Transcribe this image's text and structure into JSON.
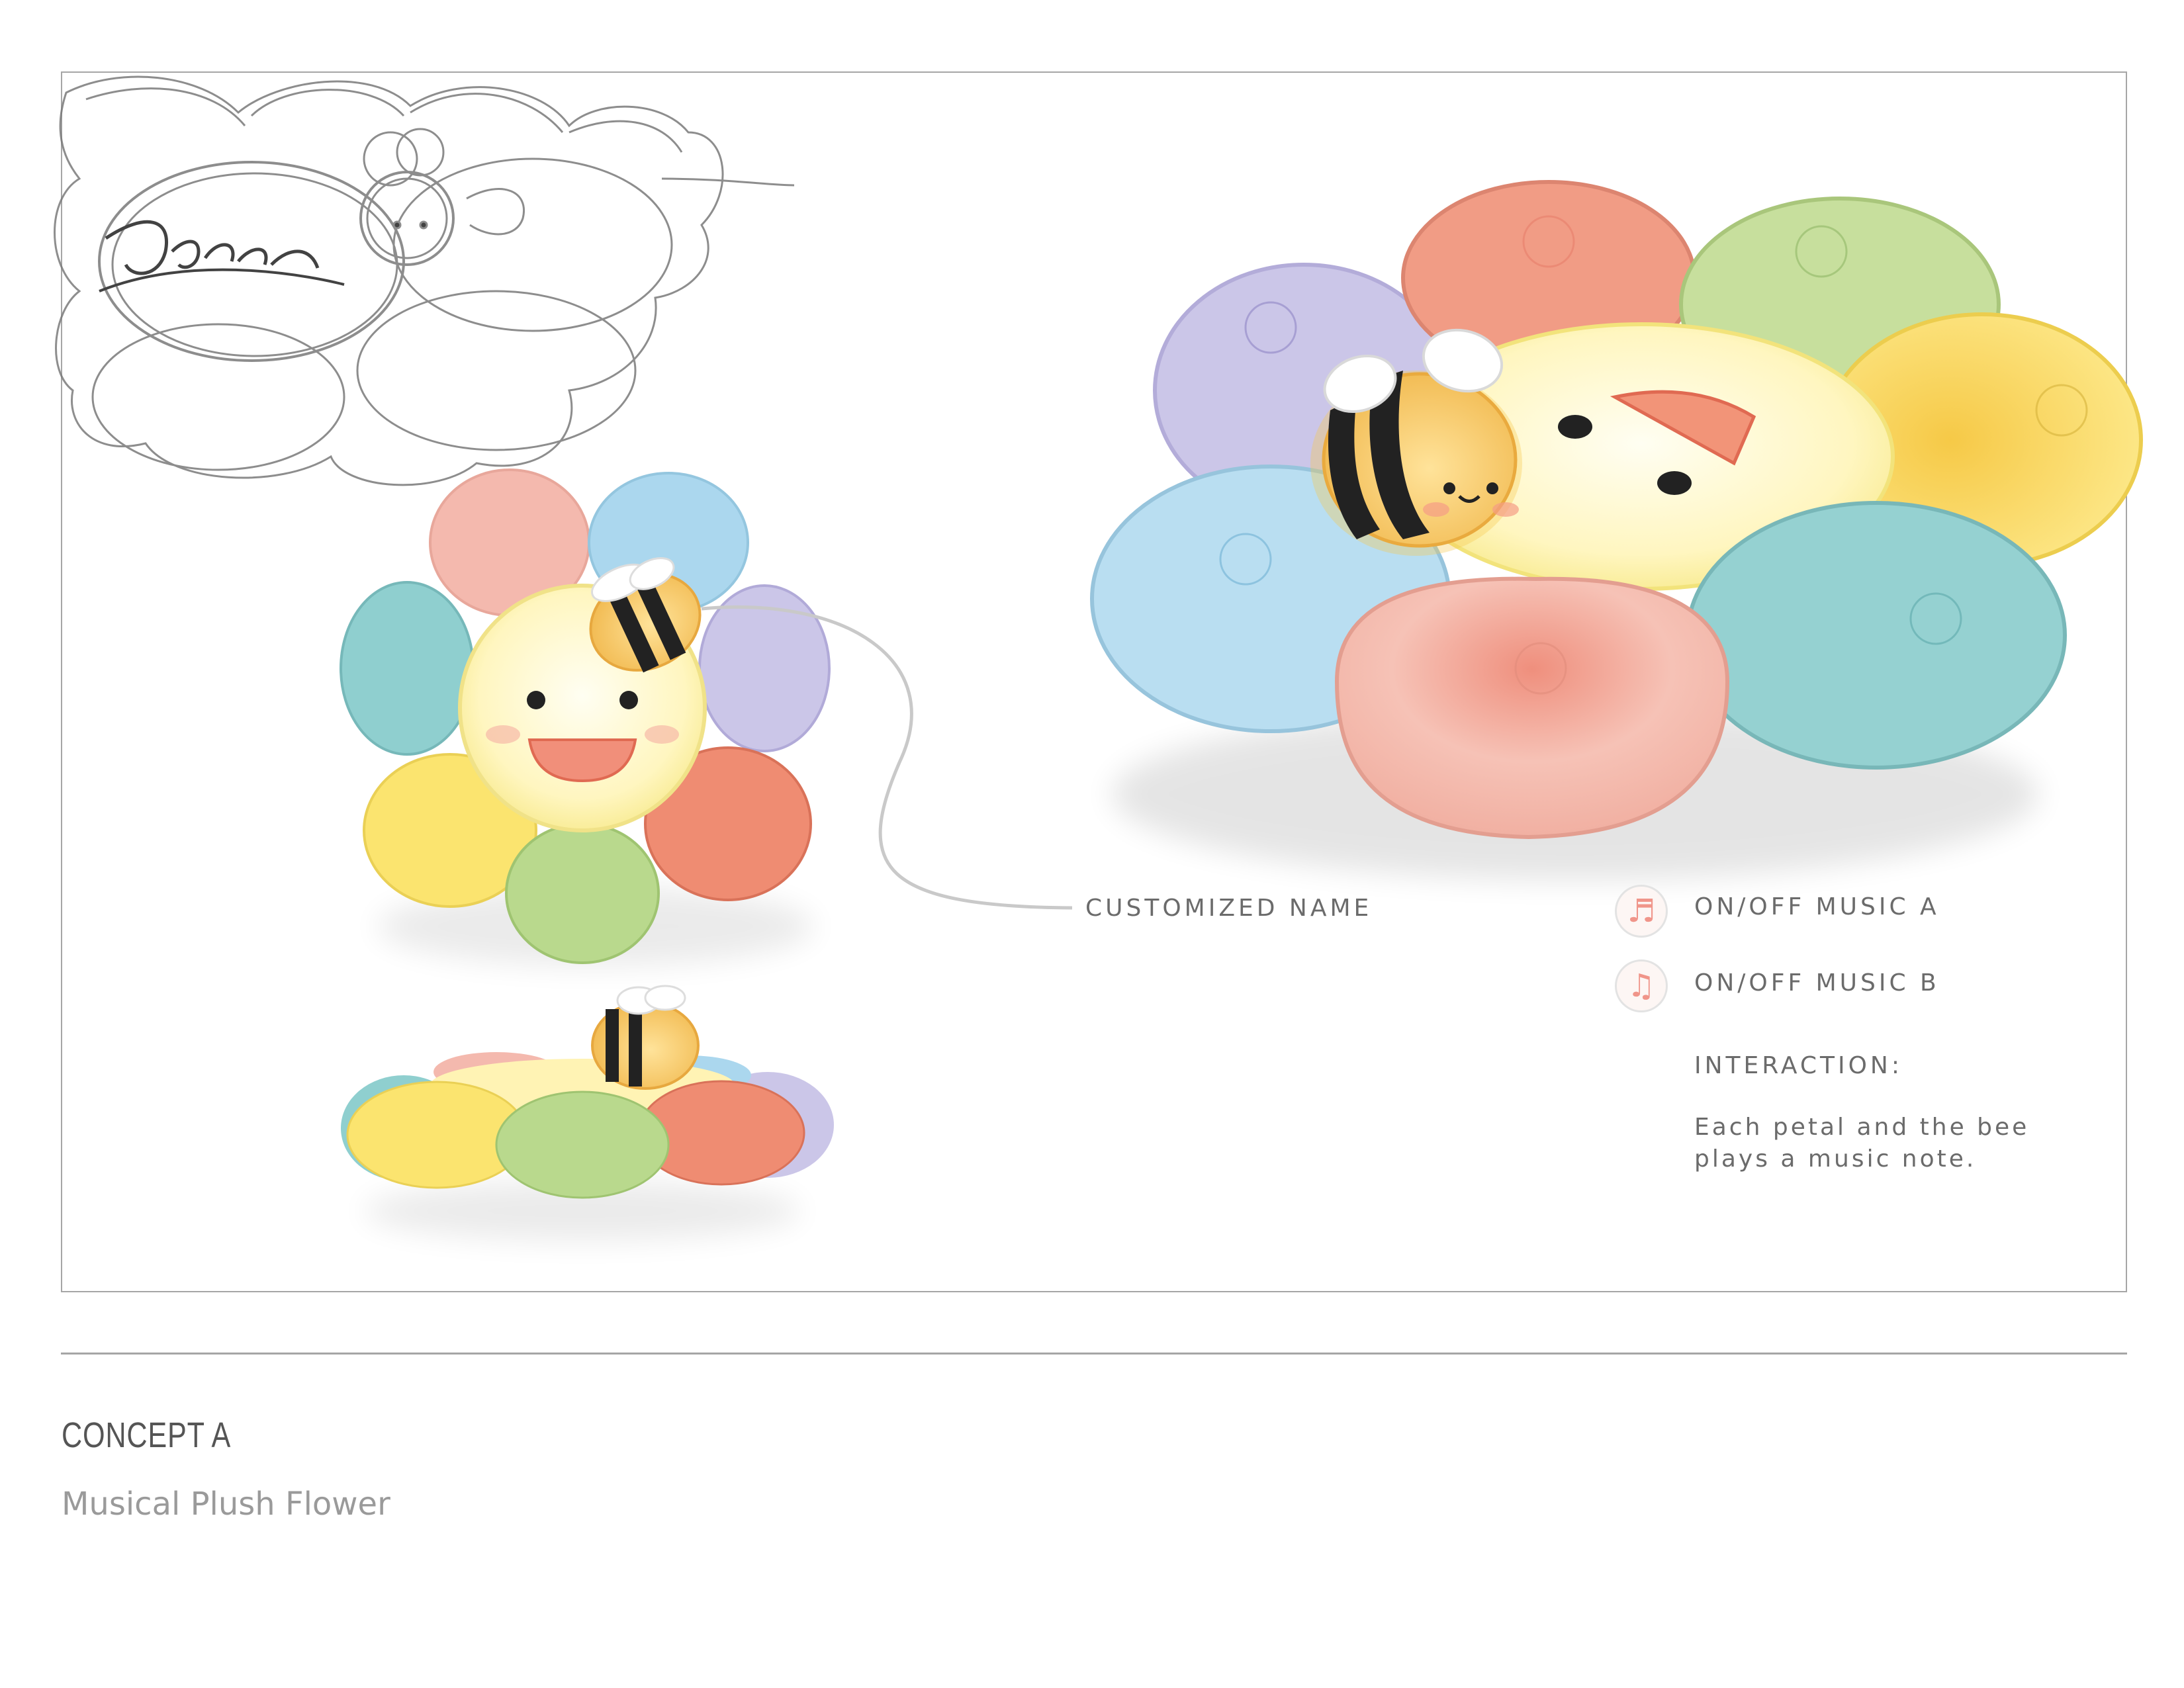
{
  "sketch": {
    "name_text": "Emma"
  },
  "callouts": {
    "customized_name": "CUSTOMIZED NAME",
    "music_a": "ON/OFF MUSIC A",
    "music_b": "ON/OFF MUSIC B",
    "interaction_heading": "INTERACTION:",
    "interaction_line1": "Each petal and the bee",
    "interaction_line2": "plays a music note."
  },
  "icons": {
    "music_a_icon": "music-note-icon",
    "music_b_icon": "music-note-icon",
    "music_a_glyph": "♬",
    "music_b_glyph": "♫"
  },
  "footer": {
    "title": "CONCEPT A",
    "subtitle": "Musical Plush Flower"
  },
  "colors": {
    "pink": "#f4b7ad",
    "blue": "#a9d8ee",
    "lavender": "#c9c3e6",
    "orange": "#ef8a6f",
    "green": "#b9d98b",
    "yellow": "#fbe36c",
    "teal": "#8fcfcf",
    "center": "#fff7c2",
    "bee": "#f7c56b",
    "text": "#6b6b6b"
  }
}
